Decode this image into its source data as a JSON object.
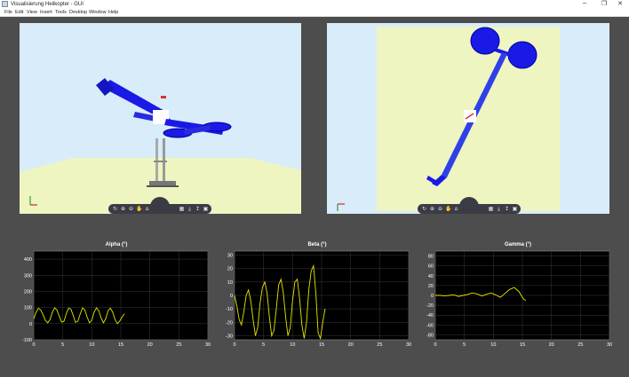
{
  "window": {
    "title": "Visualisierung Helikopter - GUI",
    "minimize_glyph": "−",
    "maximize_glyph": "❐",
    "close_glyph": "✕",
    "icon": "matlab-figure-icon"
  },
  "menu": {
    "items": [
      "File",
      "Edit",
      "View",
      "Insert",
      "Tools",
      "Desktop",
      "Window",
      "Help"
    ]
  },
  "views": {
    "background_color": "#d8ecfa",
    "ground_color": "#eef5c0",
    "model_color": "#1a1ae6",
    "toolbar_icons": [
      "rotate-icon",
      "zoom-in-icon",
      "zoom-out-icon",
      "pan-icon",
      "home-icon",
      "data-tips-icon",
      "save-icon",
      "export-icon",
      "grid-icon",
      "help-icon"
    ],
    "toolbar_glyphs": [
      "↻",
      "⊕",
      "⊖",
      "✋",
      "⌂",
      "▦",
      "⤓",
      "↥",
      "▣",
      "?"
    ]
  },
  "chart_data": [
    {
      "type": "line",
      "title": "Alpha (°)",
      "color": "#e6e600",
      "xlim": [
        0,
        30
      ],
      "ylim": [
        -100,
        450
      ],
      "xticks": [
        0,
        5,
        10,
        15,
        20,
        25,
        30
      ],
      "yticks": [
        -100,
        0,
        100,
        200,
        300,
        400
      ],
      "grid": true,
      "x": [
        0.0,
        0.4,
        0.8,
        1.2,
        1.6,
        2.0,
        2.4,
        2.8,
        3.2,
        3.6,
        4.0,
        4.4,
        4.8,
        5.2,
        5.6,
        6.0,
        6.4,
        6.8,
        7.2,
        7.6,
        8.0,
        8.4,
        8.8,
        9.2,
        9.6,
        10.0,
        10.4,
        10.8,
        11.2,
        11.6,
        12.0,
        12.4,
        12.8,
        13.2,
        13.6,
        14.0,
        14.4,
        14.8,
        15.2,
        15.6
      ],
      "y": [
        30,
        70,
        95,
        85,
        55,
        20,
        5,
        25,
        70,
        98,
        85,
        45,
        10,
        15,
        60,
        97,
        90,
        50,
        8,
        15,
        60,
        98,
        85,
        40,
        5,
        20,
        70,
        98,
        80,
        35,
        5,
        30,
        80,
        96,
        70,
        25,
        0,
        15,
        40,
        60
      ]
    },
    {
      "type": "line",
      "title": "Beta (°)",
      "color": "#e6e600",
      "xlim": [
        0,
        30
      ],
      "ylim": [
        -33,
        33
      ],
      "xticks": [
        0,
        5,
        10,
        15,
        20,
        25,
        30
      ],
      "yticks": [
        -30,
        -20,
        -10,
        0,
        10,
        20,
        30
      ],
      "grid": true,
      "x": [
        0.0,
        0.4,
        0.8,
        1.2,
        1.6,
        2.0,
        2.4,
        2.8,
        3.2,
        3.6,
        4.0,
        4.4,
        4.8,
        5.2,
        5.6,
        6.0,
        6.4,
        6.8,
        7.2,
        7.6,
        8.0,
        8.4,
        8.8,
        9.2,
        9.6,
        10.0,
        10.4,
        10.8,
        11.2,
        11.6,
        12.0,
        12.4,
        12.8,
        13.2,
        13.6,
        14.0,
        14.4,
        14.8,
        15.2,
        15.6
      ],
      "y": [
        0,
        -8,
        -18,
        -22,
        -12,
        0,
        4,
        -4,
        -18,
        -30,
        -24,
        -6,
        6,
        10,
        2,
        -16,
        -30,
        -26,
        -10,
        8,
        12,
        2,
        -16,
        -30,
        -24,
        -4,
        10,
        12,
        -2,
        -22,
        -32,
        -20,
        4,
        18,
        22,
        2,
        -28,
        -32,
        -20,
        -10
      ]
    },
    {
      "type": "line",
      "title": "Gamma (°)",
      "color": "#e6e600",
      "xlim": [
        0,
        30
      ],
      "ylim": [
        -90,
        90
      ],
      "xticks": [
        0,
        5,
        10,
        15,
        20,
        25,
        30
      ],
      "yticks": [
        -80,
        -60,
        -40,
        -20,
        0,
        20,
        40,
        60,
        80
      ],
      "grid": true,
      "x": [
        0.0,
        0.8,
        1.6,
        2.4,
        3.2,
        4.0,
        4.8,
        5.6,
        6.4,
        7.2,
        8.0,
        8.8,
        9.6,
        10.4,
        11.2,
        12.0,
        12.8,
        13.6,
        14.4,
        15.2,
        15.6
      ],
      "y": [
        0,
        0,
        -1,
        0,
        1,
        -2,
        0,
        2,
        5,
        3,
        -1,
        2,
        5,
        1,
        -4,
        4,
        12,
        16,
        8,
        -8,
        -10
      ]
    }
  ]
}
